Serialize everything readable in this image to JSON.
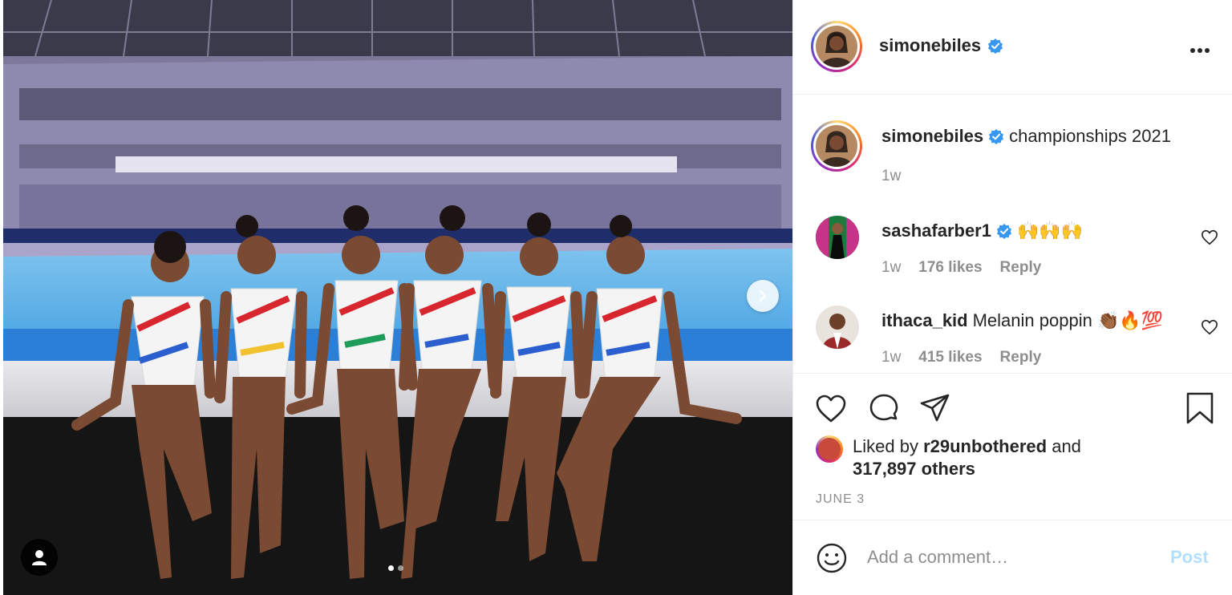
{
  "post": {
    "username": "simonebiles",
    "verified": true,
    "more_icon": "more-horizontal-icon"
  },
  "caption": {
    "username": "simonebiles",
    "text": "championships 2021",
    "time": "1w"
  },
  "comments": [
    {
      "username": "sashafarber1",
      "verified": true,
      "text": "🙌🙌🙌",
      "time": "1w",
      "likes": "176 likes",
      "reply": "Reply"
    },
    {
      "username": "ithaca_kid",
      "verified": false,
      "text": "Melanin poppin 👏🏾🔥💯",
      "time": "1w",
      "likes": "415 likes",
      "reply": "Reply"
    }
  ],
  "likes": {
    "prefix": "Liked by ",
    "user": "r29unbothered",
    "middle": " and",
    "count": "317,897 others"
  },
  "date": "JUNE 3",
  "add_comment": {
    "placeholder": "Add a comment…",
    "post_label": "Post"
  },
  "carousel": {
    "current": 1,
    "total": 2
  },
  "colors": {
    "verified": "#3897f0",
    "link_disabled": "#b2dffc",
    "muted": "#8e8e8e",
    "text": "#262626"
  }
}
